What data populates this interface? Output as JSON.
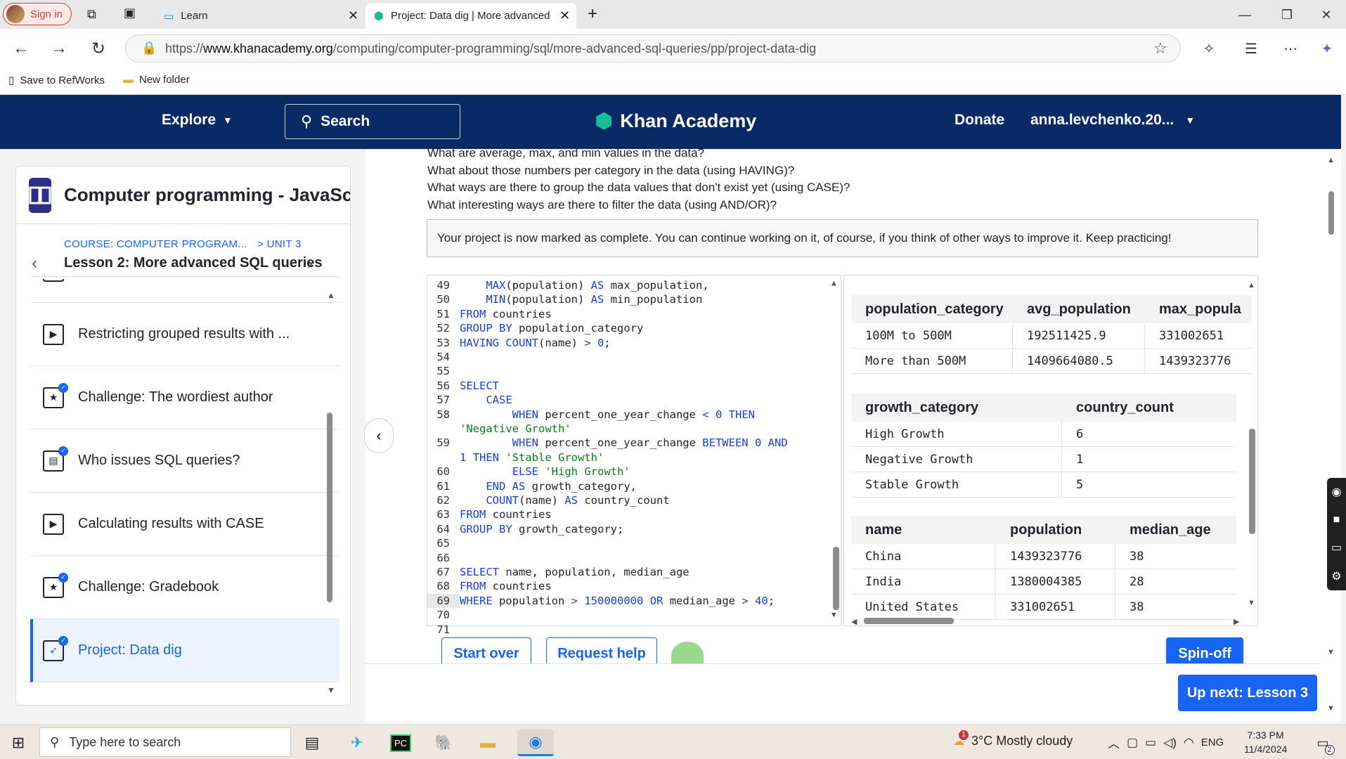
{
  "browser": {
    "signin_label": "Sign in",
    "tabs": [
      {
        "title": "Learn"
      },
      {
        "title": "Project: Data dig | More advanced"
      }
    ],
    "url_prefix": "https://",
    "url_domain": "www.khanacademy.org",
    "url_path": "/computing/computer-programming/sql/more-advanced-sql-queries/pp/project-data-dig",
    "favorites": [
      {
        "label": "Save to RefWorks"
      },
      {
        "label": "New folder"
      }
    ]
  },
  "header": {
    "explore": "Explore",
    "search": "Search",
    "logo": "Khan Academy",
    "donate": "Donate",
    "user": "anna.levchenko.20..."
  },
  "sidebar": {
    "course_title": "Computer programming - JavaScr...",
    "breadcrumb_course": "COURSE: COMPUTER PROGRAM...",
    "breadcrumb_unit": "> UNIT 3",
    "lesson_title": "Lesson 2: More advanced SQL queries",
    "items": [
      {
        "label": "Restricting grouped results with ..."
      },
      {
        "label": "Challenge: The wordiest author"
      },
      {
        "label": "Who issues SQL queries?"
      },
      {
        "label": "Calculating results with CASE"
      },
      {
        "label": "Challenge: Gradebook"
      },
      {
        "label": "Project: Data dig"
      }
    ]
  },
  "questions": [
    "What are average, max, and min values in the data?",
    "What about those numbers per category in the data (using HAVING)?",
    "What ways are there to group the data values that don't exist yet (using CASE)?",
    "What interesting ways are there to filter the data (using AND/OR)?"
  ],
  "complete_message": "Your project is now marked as complete. You can continue working on it, of course, if you think of other ways to improve it. Keep practicing!",
  "editor": {
    "lines": [
      {
        "n": "49",
        "code": "    MAX(population) AS max_population,"
      },
      {
        "n": "50",
        "code": "    MIN(population) AS min_population"
      },
      {
        "n": "51",
        "code": "FROM countries"
      },
      {
        "n": "52",
        "code": "GROUP BY population_category"
      },
      {
        "n": "53",
        "code": "HAVING COUNT(name) > 0;"
      },
      {
        "n": "54",
        "code": ""
      },
      {
        "n": "55",
        "code": ""
      },
      {
        "n": "56",
        "code": "SELECT"
      },
      {
        "n": "57",
        "code": "    CASE"
      },
      {
        "n": "58",
        "code": "        WHEN percent_one_year_change < 0 THEN"
      },
      {
        "n": "",
        "code": "'Negative Growth'"
      },
      {
        "n": "59",
        "code": "        WHEN percent_one_year_change BETWEEN 0 AND"
      },
      {
        "n": "",
        "code": "1 THEN 'Stable Growth'"
      },
      {
        "n": "60",
        "code": "        ELSE 'High Growth'"
      },
      {
        "n": "61",
        "code": "    END AS growth_category,"
      },
      {
        "n": "62",
        "code": "    COUNT(name) AS country_count"
      },
      {
        "n": "63",
        "code": "FROM countries"
      },
      {
        "n": "64",
        "code": "GROUP BY growth_category;"
      },
      {
        "n": "65",
        "code": ""
      },
      {
        "n": "66",
        "code": ""
      },
      {
        "n": "67",
        "code": "SELECT name, population, median_age"
      },
      {
        "n": "68",
        "code": "FROM countries"
      },
      {
        "n": "69",
        "code": "WHERE population > 150000000 OR median_age > 40;"
      },
      {
        "n": "70",
        "code": ""
      },
      {
        "n": "71",
        "code": ""
      }
    ]
  },
  "results": {
    "table1": {
      "headers": [
        "population_category",
        "avg_population",
        "max_popula"
      ],
      "rows": [
        [
          "100M to 500M",
          "192511425.9",
          "331002651"
        ],
        [
          "More than 500M",
          "1409664080.5",
          "1439323776"
        ]
      ]
    },
    "table2": {
      "headers": [
        "growth_category",
        "country_count"
      ],
      "rows": [
        [
          "High Growth",
          "6"
        ],
        [
          "Negative Growth",
          "1"
        ],
        [
          "Stable Growth",
          "5"
        ]
      ]
    },
    "table3": {
      "headers": [
        "name",
        "population",
        "median_age"
      ],
      "rows": [
        [
          "China",
          "1439323776",
          "38"
        ],
        [
          "India",
          "1380004385",
          "28"
        ],
        [
          "United States",
          "331002651",
          "38"
        ]
      ]
    }
  },
  "buttons": {
    "start_over": "Start over",
    "request_help": "Request help",
    "spin_off": "Spin-off",
    "up_next": "Up next: Lesson 3"
  },
  "taskbar": {
    "search_placeholder": "Type here to search",
    "weather": "3°C  Mostly cloudy",
    "weather_badge": "1",
    "lang": "ENG",
    "time": "7:33 PM",
    "date": "11/4/2024",
    "notif_count": "2"
  },
  "colors": {
    "ka_navy": "#0a2a66",
    "ka_blue": "#1865f2",
    "ka_green": "#14bf96"
  }
}
